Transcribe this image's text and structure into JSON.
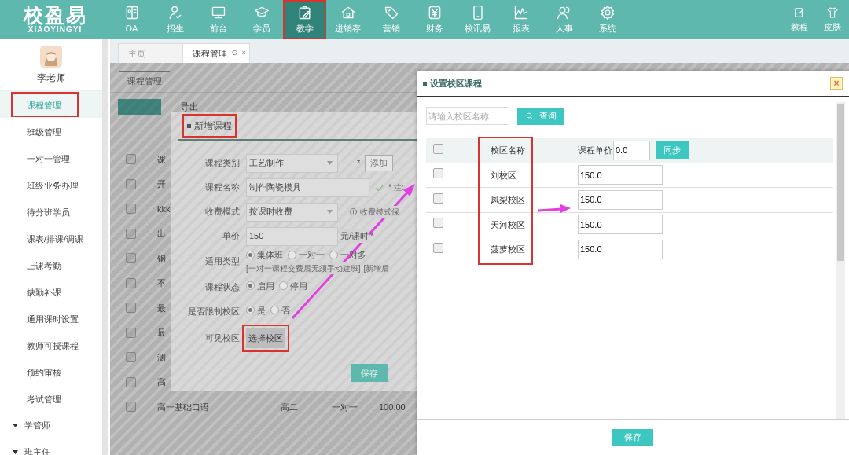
{
  "brand": {
    "name": "校盈易",
    "subtitle": "XIAOYINGYI"
  },
  "nav": [
    {
      "label": "OA",
      "selected": false,
      "annotated": false
    },
    {
      "label": "招生",
      "selected": false,
      "annotated": false
    },
    {
      "label": "前台",
      "selected": false,
      "annotated": false
    },
    {
      "label": "学员",
      "selected": false,
      "annotated": false
    },
    {
      "label": "教学",
      "selected": true,
      "annotated": true
    },
    {
      "label": "进销存",
      "selected": false,
      "annotated": false
    },
    {
      "label": "营销",
      "selected": false,
      "annotated": false
    },
    {
      "label": "财务",
      "selected": false,
      "annotated": false
    },
    {
      "label": "校讯易",
      "selected": false,
      "annotated": false
    },
    {
      "label": "报表",
      "selected": false,
      "annotated": false
    },
    {
      "label": "人事",
      "selected": false,
      "annotated": false
    },
    {
      "label": "系统",
      "selected": false,
      "annotated": false
    }
  ],
  "tools": [
    {
      "label": "教程"
    },
    {
      "label": "皮肤"
    }
  ],
  "user": {
    "name": "李老师"
  },
  "sidebar": {
    "items": [
      {
        "label": "课程管理",
        "selected": true,
        "annotated": true
      },
      {
        "label": "班级管理",
        "selected": false,
        "annotated": false
      },
      {
        "label": "一对一管理",
        "selected": false,
        "annotated": false
      },
      {
        "label": "班级业务办理",
        "selected": false,
        "annotated": false
      },
      {
        "label": "待分班学员",
        "selected": false,
        "annotated": false
      },
      {
        "label": "课表/排课/调课",
        "selected": false,
        "annotated": false
      },
      {
        "label": "上课考勤",
        "selected": false,
        "annotated": false
      },
      {
        "label": "缺勤补课",
        "selected": false,
        "annotated": false
      },
      {
        "label": "通用课时设置",
        "selected": false,
        "annotated": false
      },
      {
        "label": "教师可授课程",
        "selected": false,
        "annotated": false
      },
      {
        "label": "预约审核",
        "selected": false,
        "annotated": false
      },
      {
        "label": "考试管理",
        "selected": false,
        "annotated": false
      }
    ],
    "groups": [
      {
        "label": "学管师"
      },
      {
        "label": "班主任"
      }
    ]
  },
  "page_tabs": [
    {
      "label": "主页",
      "selected": false
    },
    {
      "label": "课程管理",
      "selected": true,
      "refresh": "C",
      "close": "×"
    }
  ],
  "course_page": {
    "tabs": [
      {
        "label": "课程管理",
        "selected": true
      }
    ],
    "export": "导出",
    "rows": [
      {
        "name": "课",
        "checked": false
      },
      {
        "name": "开",
        "checked": false
      },
      {
        "name": "kkk",
        "checked": false
      },
      {
        "name": "出",
        "checked": false
      },
      {
        "name": "钢",
        "checked": false
      },
      {
        "name": "不",
        "checked": false
      },
      {
        "name": "最",
        "checked": false
      },
      {
        "name": "最",
        "checked": false
      },
      {
        "name": "测",
        "checked": false
      },
      {
        "name": "高",
        "checked": false
      },
      {
        "name": "高一基础口语",
        "grade": "高二",
        "type": "一对一",
        "price": "100.00",
        "checked": false
      }
    ]
  },
  "new_course_dialog": {
    "title": "新增课程",
    "annotated": true,
    "save": "保存",
    "fields": [
      {
        "kind": "select",
        "label": "课程类别",
        "value": "工艺制作",
        "required": "*",
        "action": "添加"
      },
      {
        "kind": "input",
        "label": "课程名称",
        "value": "制作陶瓷模具",
        "valid": true,
        "note": "* 注:"
      },
      {
        "kind": "select",
        "label": "收费模式",
        "value": "按课时收费",
        "hint": "收费模式保"
      },
      {
        "kind": "input",
        "label": "单价",
        "value": "150",
        "unit": "元/课时",
        "required": "*"
      },
      {
        "kind": "radio",
        "label": "适用类型",
        "options": [
          {
            "label": "集体班",
            "selected": true
          },
          {
            "label": "一对一",
            "selected": false
          },
          {
            "label": "一对多",
            "selected": false
          }
        ],
        "note": "[一对一课程交费后无须手动建班]",
        "note2": "[新增后"
      },
      {
        "kind": "radio",
        "label": "课程状态",
        "options": [
          {
            "label": "启用",
            "selected": true
          },
          {
            "label": "停用",
            "selected": false
          }
        ]
      },
      {
        "kind": "radio",
        "label": "是否限制校区",
        "options": [
          {
            "label": "是",
            "selected": true
          },
          {
            "label": "否",
            "selected": false
          }
        ]
      },
      {
        "kind": "button",
        "label": "可见校区",
        "action": "选择校区",
        "annotated": true
      }
    ]
  },
  "campus_dialog": {
    "title": "设置校区课程",
    "close": "×",
    "search": {
      "placeholder": "请输入校区名称",
      "button": "查询"
    },
    "header_checked": false,
    "columns": [
      {
        "label": "校区名称",
        "annotated": true
      },
      {
        "label": "课程单价",
        "annotated": false
      }
    ],
    "bulk_price": "0.0",
    "sync": "同步",
    "rows": [
      {
        "name": "刘校区",
        "price": "150.0",
        "checked": false
      },
      {
        "name": "凤梨校区",
        "price": "150.0",
        "checked": false
      },
      {
        "name": "天河校区",
        "price": "150.0",
        "checked": false
      },
      {
        "name": "菠萝校区",
        "price": "150.0",
        "checked": false
      }
    ],
    "save": "保存"
  }
}
